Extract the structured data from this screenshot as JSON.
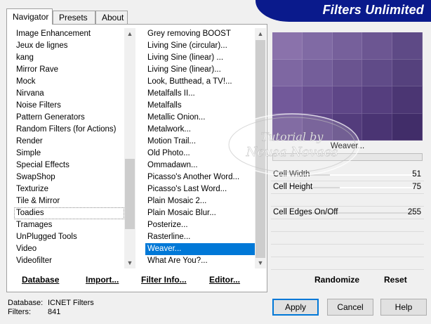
{
  "banner": {
    "title": "Filters Unlimited"
  },
  "tabs": [
    {
      "label": "Navigator",
      "active": true
    },
    {
      "label": "Presets",
      "active": false
    },
    {
      "label": "About",
      "active": false
    }
  ],
  "categories": {
    "items": [
      "Image Enhancement",
      "Jeux de lignes",
      "kang",
      "Mirror Rave",
      "Mock",
      "Nirvana",
      "Noise Filters",
      "Pattern Generators",
      "Random Filters (for Actions)",
      "Render",
      "Simple",
      "Special Effects",
      "SwapShop",
      "Texturize",
      "Tile & Mirror",
      "Toadies",
      "Tramages",
      "UnPlugged Tools",
      "Video",
      "Videofilter"
    ],
    "focused_index": 15
  },
  "filters": {
    "items": [
      "Grey removing BOOST",
      "Living Sine (circular)...",
      "Living Sine (linear) ...",
      "Living Sine (linear)...",
      "Look, Butthead, a TV!...",
      "Metalfalls II...",
      "Metalfalls",
      "Metallic Onion...",
      "Metalwork...",
      "Motion Trail...",
      "Old Photo...",
      "Ommadawn...",
      "Picasso's Another Word...",
      "Picasso's Last Word...",
      "Plain Mosaic 2...",
      "Plain Mosaic Blur...",
      "Posterize...",
      "Rasterline...",
      "Weaver...",
      "What Are You?..."
    ],
    "selected_index": 18
  },
  "left_buttons": {
    "database": "Database",
    "import": "Import...",
    "filter_info": "Filter Info...",
    "editor": "Editor..."
  },
  "preview": {
    "filter_name": "Weaver...",
    "colors": [
      "#8a72ab",
      "#806aa4",
      "#76609b",
      "#6c5692",
      "#5e4a86",
      "#7e67a2",
      "#745e9a",
      "#6a5490",
      "#604b88",
      "#55417d",
      "#72599a",
      "#684f90",
      "#5e4687",
      "#553e7e",
      "#4b3673",
      "#674c8f",
      "#5d4486",
      "#533c7c",
      "#4a3473",
      "#412d69"
    ]
  },
  "params": [
    {
      "name": "Cell Width",
      "value": "51",
      "fraction": 0.2
    },
    {
      "name": "Cell Height",
      "value": "75",
      "fraction": 0.29
    },
    {
      "name": "Cell Edges On/Off",
      "value": "255",
      "fraction": 1.0
    }
  ],
  "right_buttons": {
    "randomize": "Randomize",
    "reset": "Reset"
  },
  "status": {
    "database_label": "Database:",
    "database_value": "ICNET Filters",
    "filters_label": "Filters:",
    "filters_value": "841"
  },
  "buttons": {
    "apply": "Apply",
    "cancel": "Cancel",
    "help": "Help"
  },
  "watermark": {
    "line1": "Tutorial by",
    "line2": "Neusa Novaes"
  }
}
